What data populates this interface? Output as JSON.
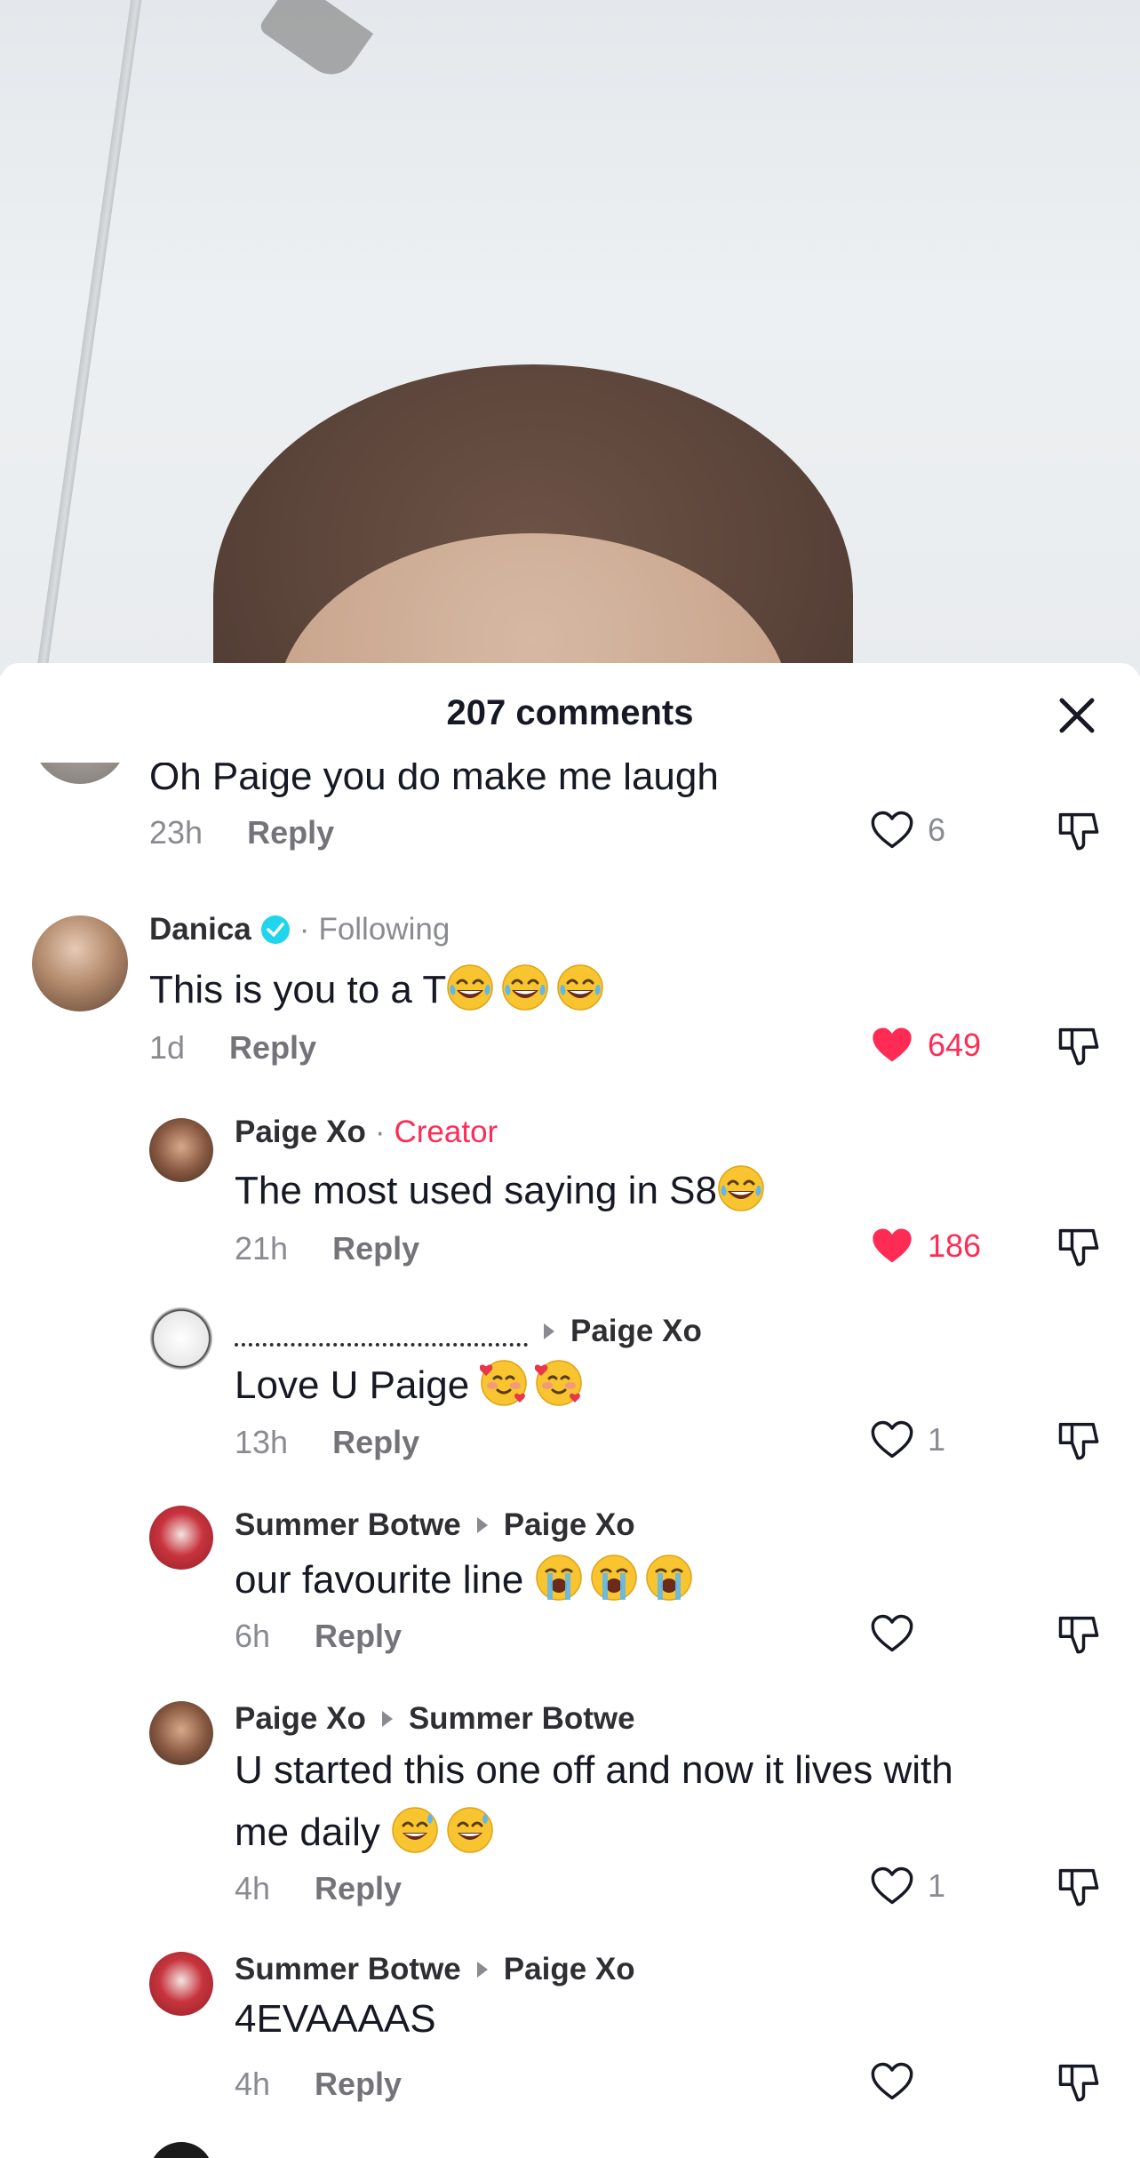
{
  "header": {
    "title": "207 comments"
  },
  "colors": {
    "accent": "#fe2c55",
    "verified": "#20d5ec",
    "muted": "#8a8b91"
  },
  "comments": [
    {
      "text": "Oh Paige you do make me laugh",
      "time": "23h",
      "reply": "Reply",
      "likes": "6",
      "liked": false
    },
    {
      "username": "Danica",
      "status": "Following",
      "text": "This is you to a T",
      "time": "1d",
      "reply": "Reply",
      "likes": "649",
      "liked": true
    },
    {
      "username": "Paige Xo",
      "badge": "Creator",
      "text": "The most used saying in S8",
      "time": "21h",
      "reply": "Reply",
      "likes": "186",
      "liked": true
    },
    {
      "reply_to": "Paige Xo",
      "text": "Love U Paige",
      "time": "13h",
      "reply": "Reply",
      "likes": "1",
      "liked": false
    },
    {
      "username": "Summer Botwe",
      "reply_to": "Paige Xo",
      "text": "our favourite line",
      "time": "6h",
      "reply": "Reply",
      "liked": false
    },
    {
      "username": "Paige Xo",
      "reply_to": "Summer Botwe",
      "text_line1": "U started this one off and now it lives with",
      "text_line2": "me daily",
      "time": "4h",
      "reply": "Reply",
      "likes": "1",
      "liked": false
    },
    {
      "username": "Summer Botwe",
      "reply_to": "Paige Xo",
      "text": "4EVAAAAS",
      "time": "4h",
      "reply": "Reply",
      "liked": false
    }
  ]
}
